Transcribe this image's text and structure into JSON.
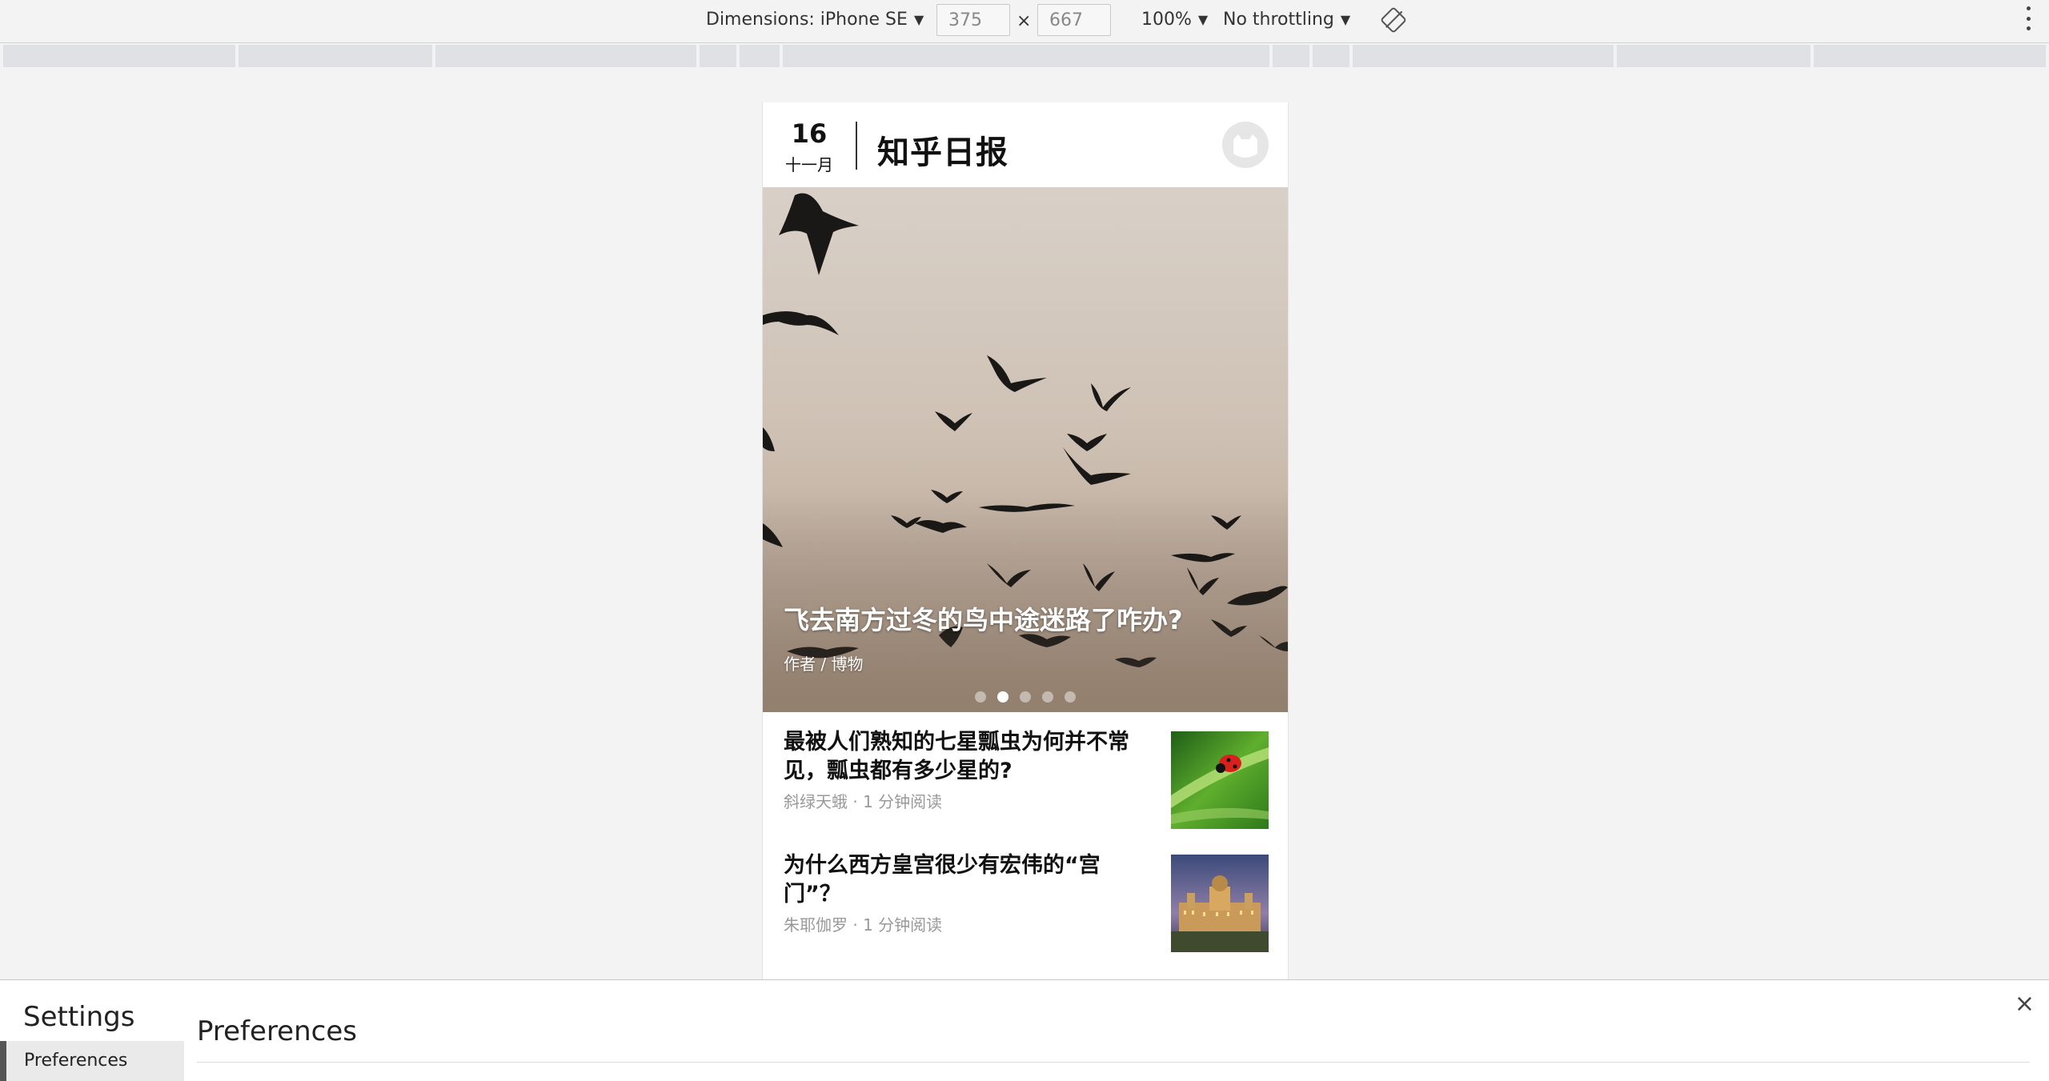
{
  "toolbar": {
    "device_label": "Dimensions: iPhone SE",
    "width": "375",
    "times": "×",
    "height": "667",
    "zoom": "100%",
    "throttling": "No throttling",
    "icons": [
      "caret-down-icon",
      "rotate-icon",
      "more-options-icon"
    ]
  },
  "app": {
    "date_day": "16",
    "date_month": "十一月",
    "brand": "知乎日报",
    "hero": {
      "title": "飞去南方过冬的鸟中途迷路了咋办?",
      "meta": "作者 / 博物",
      "carousel_total": 5,
      "carousel_active": 2
    },
    "stories": [
      {
        "title": "最被人们熟知的七星瓢虫为何并不常见，瓢虫都有多少星的?",
        "meta": "斜绿天蛾 · 1 分钟阅读"
      },
      {
        "title": "为什么西方皇宫很少有宏伟的“宫门”？",
        "meta": "朱耶伽罗 · 1 分钟阅读"
      }
    ]
  },
  "settings": {
    "title": "Settings",
    "nav_item": "Preferences",
    "section_title": "Preferences",
    "close_glyph": "×"
  }
}
